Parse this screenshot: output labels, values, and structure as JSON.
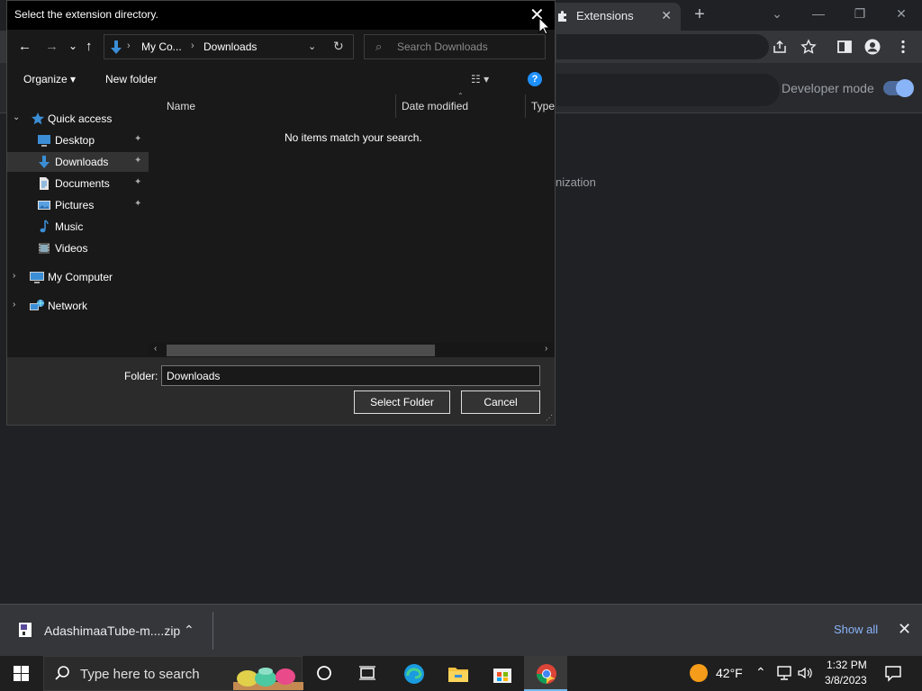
{
  "chrome": {
    "tab_title": "Extensions",
    "tab_close": "✕",
    "new_tab": "+",
    "window_controls": {
      "collapse": "⌄",
      "minimize": "—",
      "restore": "❐",
      "close": "✕"
    },
    "header": {
      "developer_mode_label": "Developer mode",
      "developer_mode_on": true
    },
    "partial_text": "nization"
  },
  "dialog": {
    "title": "Select the extension directory.",
    "close": "✕",
    "nav": {
      "back": "←",
      "forward": "→",
      "recent": "⌄",
      "up": "↑"
    },
    "breadcrumb": [
      "My Co...",
      "Downloads"
    ],
    "breadcrumb_sep": "›",
    "address_dropdown": "⌄",
    "refresh": "↻",
    "search_placeholder": "Search Downloads",
    "toolbar": {
      "organize": "Organize ▾",
      "new_folder": "New folder",
      "view": "☷ ▾",
      "help": "?"
    },
    "tree": {
      "quick_access": "Quick access",
      "desktop": "Desktop",
      "downloads": "Downloads",
      "documents": "Documents",
      "pictures": "Pictures",
      "music": "Music",
      "videos": "Videos",
      "my_computer": "My Computer",
      "network": "Network",
      "pin": "📌",
      "expanded": "⌄",
      "collapsed": "›"
    },
    "columns": [
      "Name",
      "Date modified",
      "Type"
    ],
    "sort_indicator": "⌃",
    "empty_message": "No items match your search.",
    "scroll_left": "‹",
    "scroll_right": "›",
    "folder_label": "Folder:",
    "folder_value": "Downloads",
    "select_button": "Select Folder",
    "cancel_button": "Cancel"
  },
  "download_bar": {
    "filename": "AdashimaaTube-m....zip",
    "chevron": "⌃",
    "show_all": "Show all",
    "close": "✕"
  },
  "taskbar": {
    "search_placeholder": "Type here to search",
    "temperature": "42°F",
    "tray_chevron": "⌃",
    "time": "1:32 PM",
    "date": "3/8/2023"
  },
  "colors": {
    "accent_blue": "#8ab4f8",
    "help_blue": "#1e90ff",
    "weather_orange": "#f59c1a"
  },
  "icons": {
    "tab": "puzzle-icon",
    "download_file": "zip-file-icon",
    "start": "windows-logo-icon",
    "search": "search-icon",
    "cortana": "cortana-circle-icon",
    "task_view": "task-view-icon",
    "edge": "edge-icon",
    "explorer": "file-explorer-icon",
    "store": "store-icon",
    "chrome": "chrome-icon",
    "network_tray": "network-icon",
    "volume": "volume-icon",
    "notifications": "notification-icon"
  }
}
